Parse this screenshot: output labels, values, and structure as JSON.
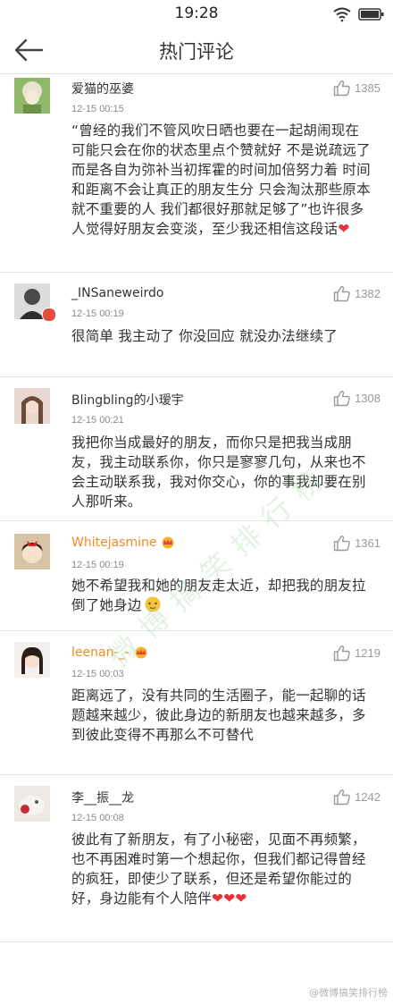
{
  "status_bar": {
    "time": "19:28"
  },
  "nav": {
    "title": "热门评论"
  },
  "comments": [
    {
      "username": "爱猫的巫婆",
      "time": "12-15 00:15",
      "likes": "1385",
      "text": "“曾经的我们不管风吹日晒也要在一起胡闹现在可能只会在你的状态里点个赞就好 不是说疏远了而是各自为弥补当初挥霍的时间加倍努力着 时间和距离不会让真正的朋友生分 只会淘汰那些原本就不重要的人 我们都很好那就足够了”也许很多人觉得好朋友会变淡，至少我还相信这段话",
      "emoji": "❤"
    },
    {
      "username": "_INSaneweirdo",
      "time": "12-15 00:19",
      "likes": "1382",
      "text": "很简单 我主动了 你没回应 就没办法继续了"
    },
    {
      "username": "Blingbling的小瑷宇",
      "time": "12-15 00:21",
      "likes": "1308",
      "text": "我把你当成最好的朋友，而你只是把我当成朋友，我主动联系你，你只是寥寥几句，从来也不会主动联系我，我对你交心，你的事我却要在别人那听来。"
    },
    {
      "username": "Whitejasmine",
      "time": "12-15 00:19",
      "likes": "1361",
      "text": "她不希望我和她的朋友走太近，却把我的朋友拉倒了她身边"
    },
    {
      "username": "leenan-_-",
      "time": "12-15 00:03",
      "likes": "1219",
      "text": "距离远了，没有共同的生活圈子，能一起聊的话题越来越少，彼此身边的新朋友也越来越多，多到彼此变得不再那么不可替代"
    },
    {
      "username": "李__振__龙",
      "time": "12-15 00:08",
      "likes": "1242",
      "text": "彼此有了新朋友，有了小秘密，见面不再频繁，也不再困难时第一个想起你，但我们都记得曾经的疯狂，即使少了联系，但还是希望你能过的好，身边能有个人陪伴",
      "emoji": "❤❤❤"
    }
  ],
  "watermark": "微博搞笑排行榜",
  "credit": "@微博搞笑排行榜",
  "colors": {
    "heart": "#e8313a",
    "vip_name": "#f28a1f",
    "like_gray": "#9a9a9a"
  }
}
